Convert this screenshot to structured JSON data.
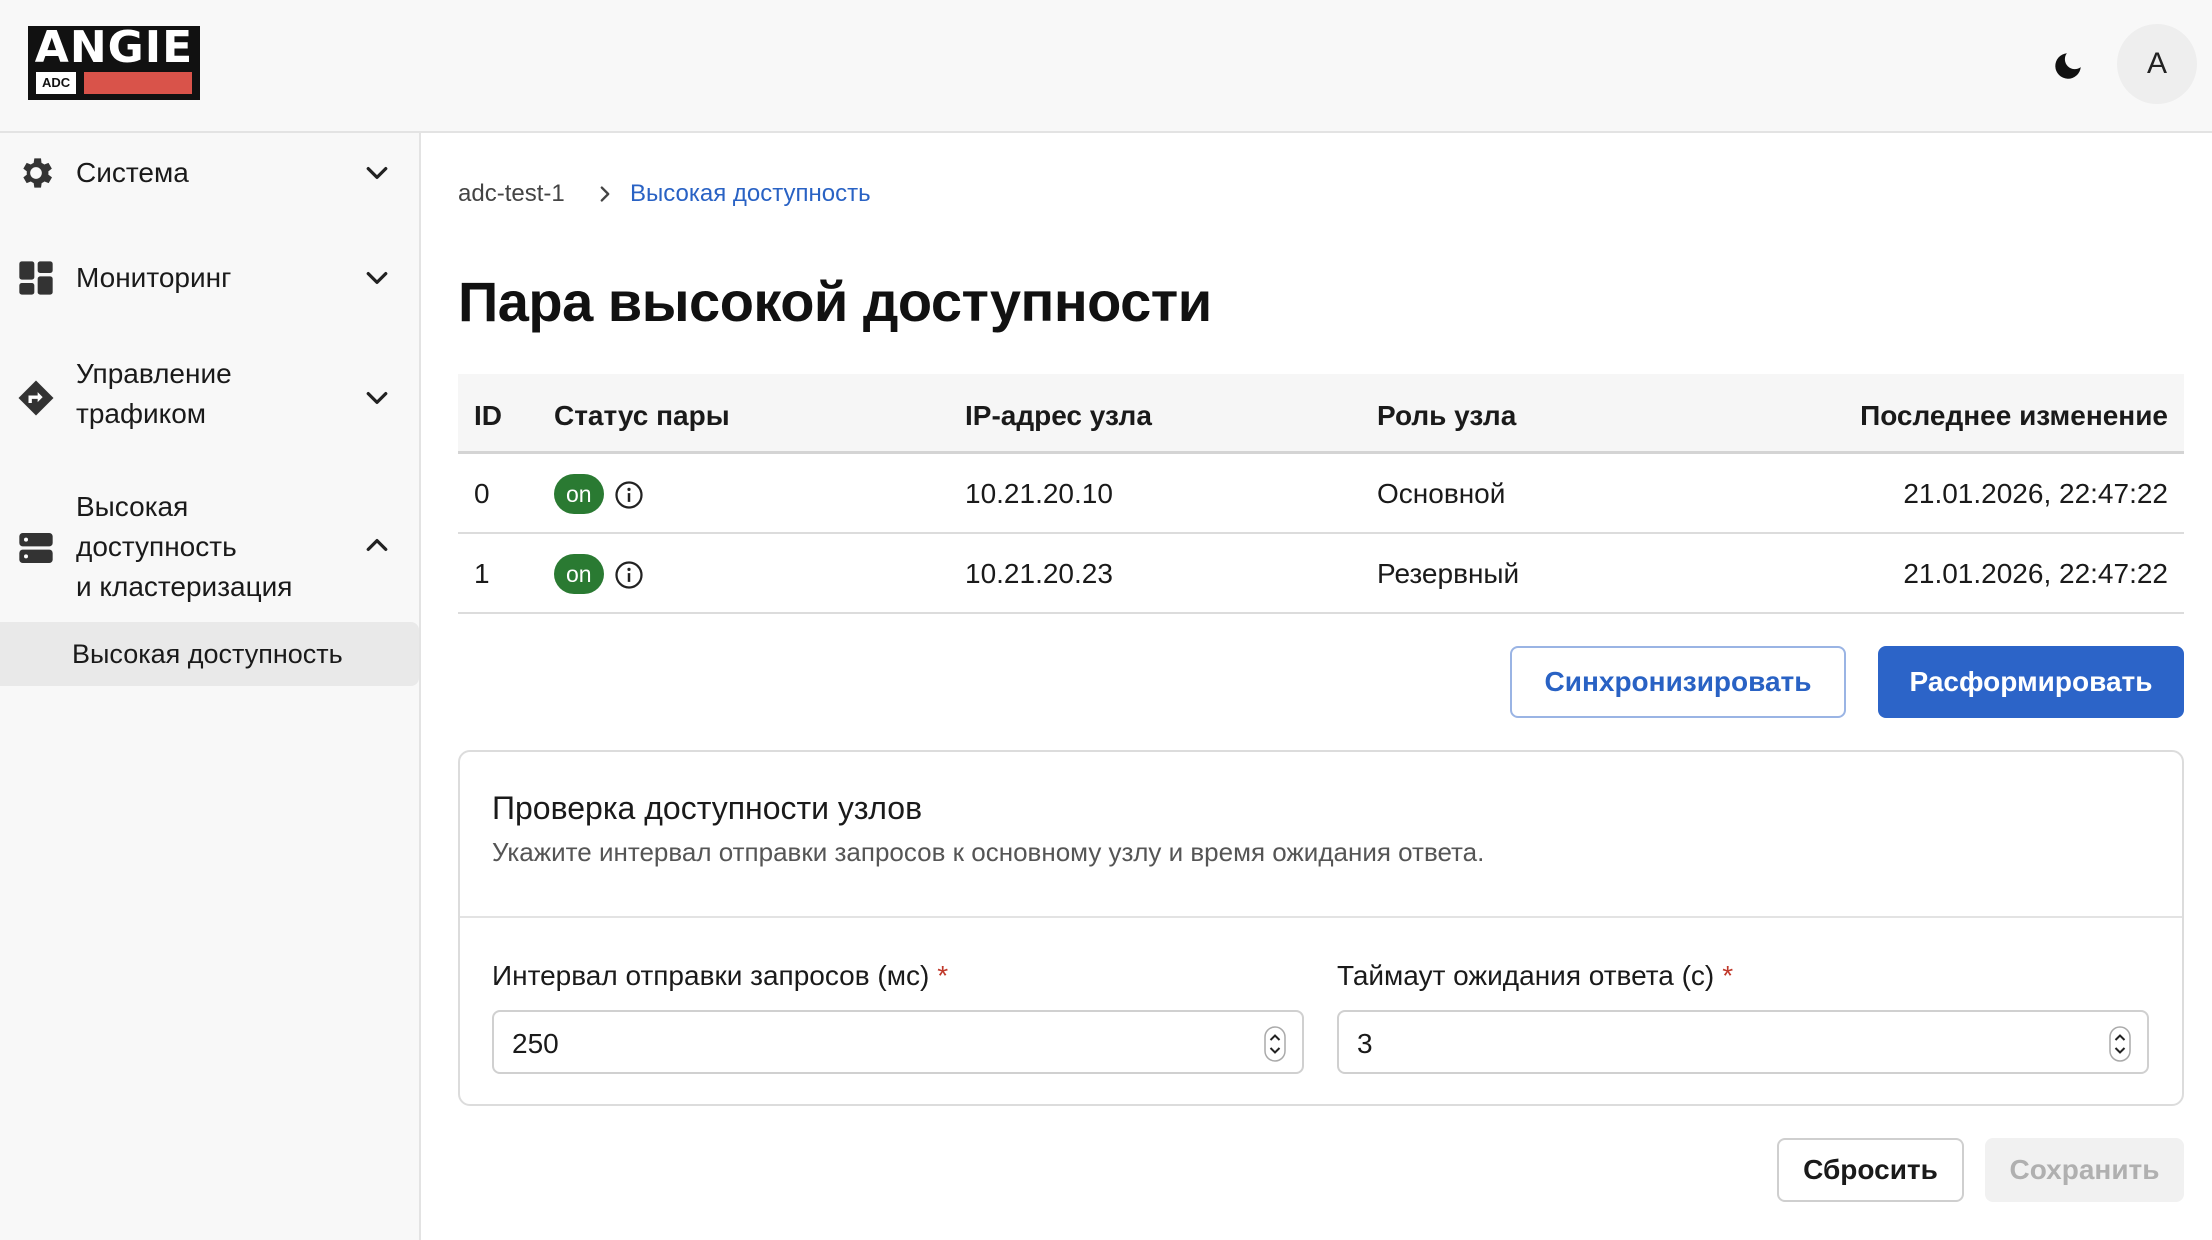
{
  "brand": {
    "logo_text": "ANGIE",
    "logo_sub": "ADC"
  },
  "header": {
    "avatar_letter": "A"
  },
  "sidebar": {
    "items": [
      {
        "label": "Система",
        "icon": "gear-icon",
        "expanded": false
      },
      {
        "label": "Мониторинг",
        "icon": "dashboard-icon",
        "expanded": false
      },
      {
        "label_line1": "Управление",
        "label_line2": "трафиком",
        "icon": "route-icon",
        "expanded": false
      },
      {
        "label_line1": "Высокая",
        "label_line2": "доступность",
        "label_line3": "и кластеризация",
        "icon": "server-icon",
        "expanded": true
      }
    ],
    "subitem": "Высокая доступность"
  },
  "breadcrumb": {
    "root": "adc-test-1",
    "current": "Высокая доступность"
  },
  "page": {
    "title": "Пара высокой доступности"
  },
  "table": {
    "headers": {
      "id": "ID",
      "status": "Статус пары",
      "ip": "IP-адрес узла",
      "role": "Роль узла",
      "changed": "Последнее изменение"
    },
    "rows": [
      {
        "id": "0",
        "status": "on",
        "ip": "10.21.20.10",
        "role": "Основной",
        "changed": "21.01.2026, 22:47:22"
      },
      {
        "id": "1",
        "status": "on",
        "ip": "10.21.20.23",
        "role": "Резервный",
        "changed": "21.01.2026, 22:47:22"
      }
    ]
  },
  "actions": {
    "sync": "Синхронизировать",
    "disband": "Расформировать"
  },
  "card": {
    "title": "Проверка доступности узлов",
    "description": "Укажите интервал отправки запросов к основному узлу и время ожидания ответа.",
    "interval": {
      "label": "Интервал отправки запросов (мс)",
      "required": "*",
      "value": "250"
    },
    "timeout": {
      "label": "Таймаут ожидания ответа (с)",
      "required": "*",
      "value": "3"
    }
  },
  "footer": {
    "reset": "Сбросить",
    "save": "Сохранить"
  },
  "colors": {
    "accent": "#2c64c8",
    "status_on": "#2a7a32",
    "required": "#c0392b",
    "logo_bar": "#d9534a"
  }
}
